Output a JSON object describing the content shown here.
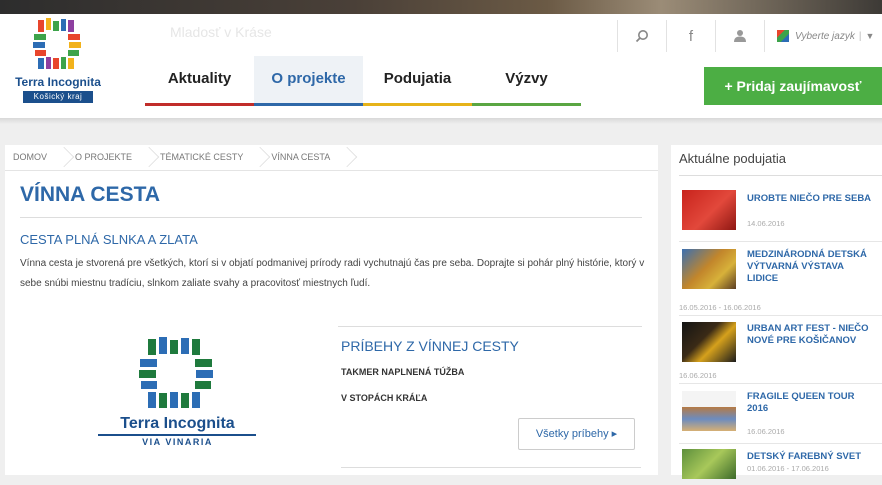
{
  "header": {
    "logo": {
      "name": "Terra Incognita",
      "region": "Košický kraj"
    },
    "ghost_title": "Mladosť v Kráse",
    "tools": {
      "search_icon": "search-icon",
      "facebook": "f",
      "user_icon": "user-icon"
    },
    "language": {
      "label": "Vyberte jazyk",
      "separator": "|",
      "arrow": "▼"
    }
  },
  "nav": {
    "items": [
      {
        "label": "Aktuality"
      },
      {
        "label": "O projekte"
      },
      {
        "label": "Podujatia"
      },
      {
        "label": "Výzvy"
      }
    ],
    "add_button": "+ Pridaj zaujímavosť"
  },
  "breadcrumb": [
    "DOMOV",
    "O PROJEKTE",
    "TÉMATICKÉ CESTY",
    "VÍNNA CESTA"
  ],
  "main": {
    "title": "VÍNNA CESTA",
    "subtitle": "CESTA PLNÁ SLNKA A ZLATA",
    "intro": "Vínna cesta je stvorená pre všetkých, ktorí si v objatí podmanivej prírody radi vychutnajú čas pre seba. Doprajte si pohár plný histórie, ktorý v sebe snúbi miestnu tradíciu, slnkom zaliate svahy a pracovitosť miestnych ľudí.",
    "logo_big": {
      "name": "Terra Incognita",
      "sub": "VIA VINARIA"
    },
    "stories": {
      "title": "PRÍBEHY Z VÍNNEJ CESTY",
      "items": [
        "TAKMER NAPLNENÁ TÚŽBA",
        "V STOPÁCH KRÁĽA"
      ],
      "all_button": "Všetky príbehy ▸"
    }
  },
  "sidebar": {
    "title": "Aktuálne podujatia",
    "events": [
      {
        "title": "UROBTE NIEČO PRE SEBA",
        "date": "14.06.2016"
      },
      {
        "title": "MEDZINÁRODNÁ DETSKÁ VÝTVARNÁ VÝSTAVA LIDICE",
        "date": "16.05.2016 - 16.06.2016"
      },
      {
        "title": "URBAN ART FEST - NIEČO NOVÉ PRE KOŠIČANOV",
        "date": "16.06.2016"
      },
      {
        "title": "FRAGILE QUEEN TOUR 2016",
        "date": "16.06.2016"
      },
      {
        "title": "DETSKÝ FAREBNÝ SVET",
        "date": "01.06.2016 - 17.06.2016"
      }
    ]
  },
  "colors": {
    "accent_blue": "#2e68a8",
    "logo_blue": "#1b4f8c",
    "add_green": "#4cae44",
    "nav_red": "#c12d2a",
    "nav_yellow": "#e6b319",
    "nav_green": "#5aa642"
  }
}
